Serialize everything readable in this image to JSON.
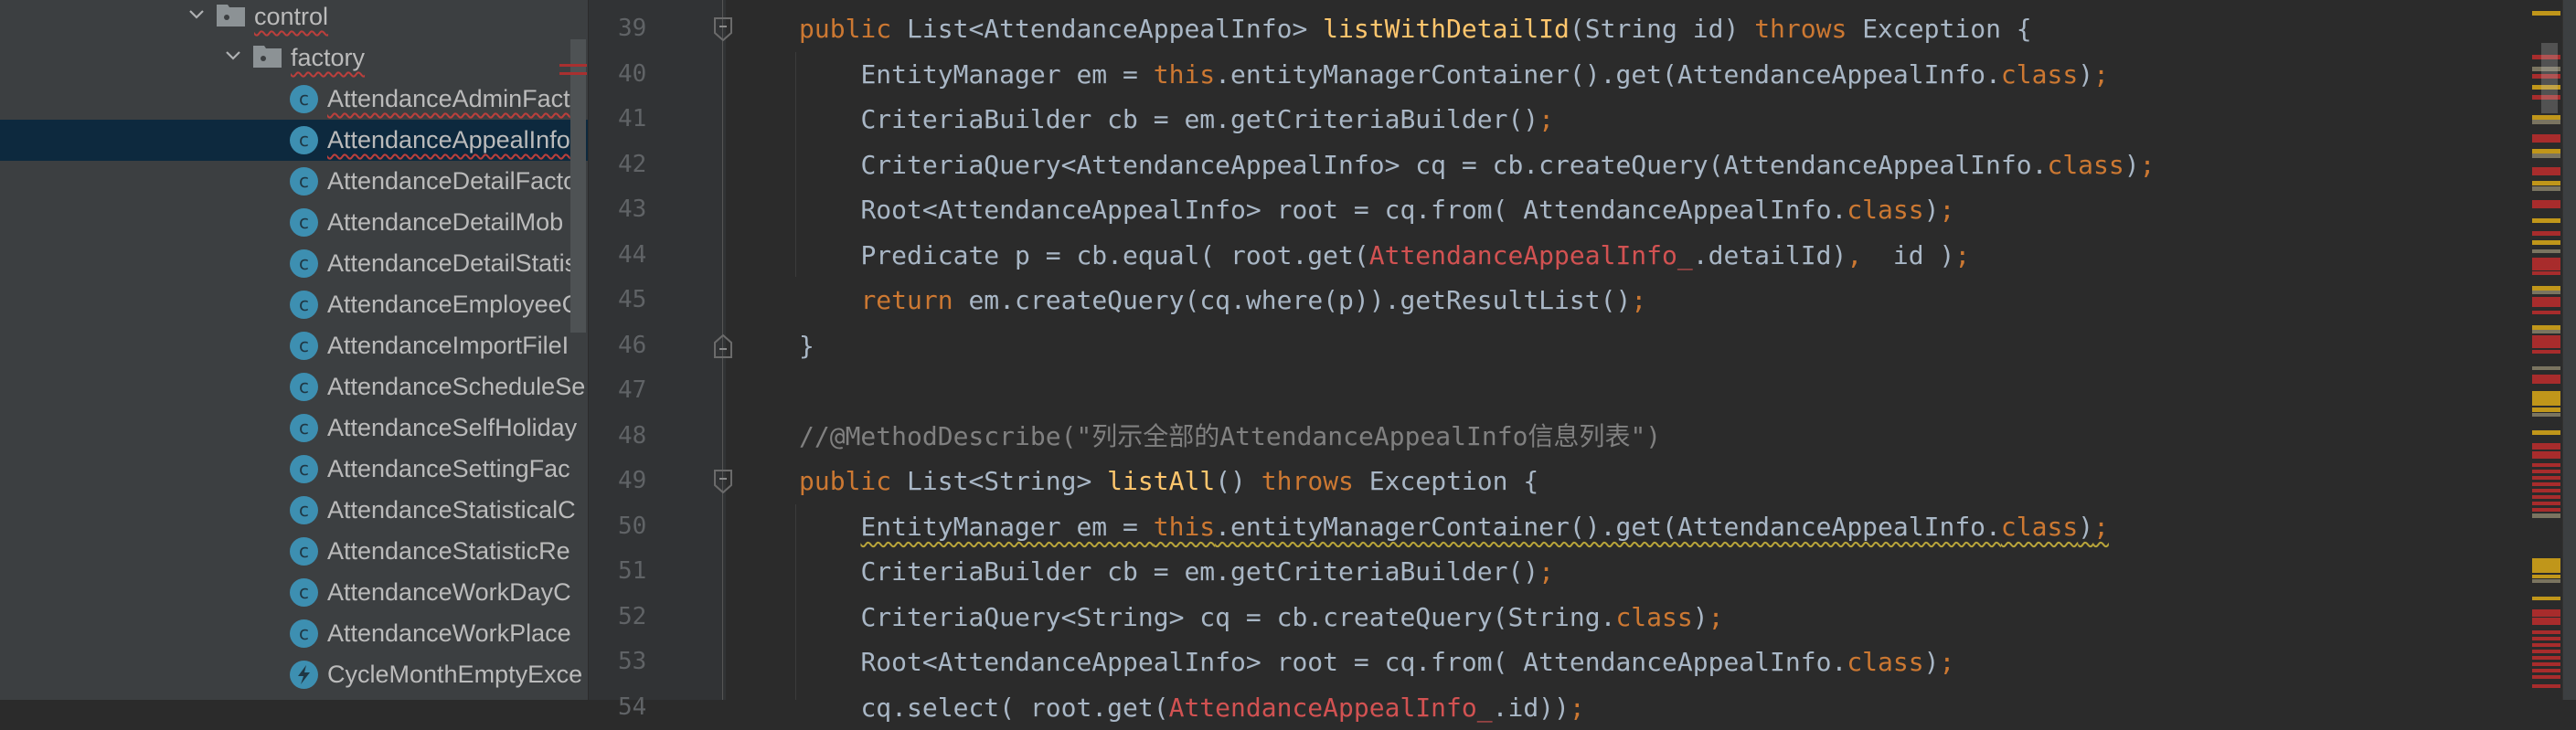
{
  "project_tree": {
    "folders": [
      {
        "name": "control",
        "expanded": true
      },
      {
        "name": "factory",
        "expanded": true
      }
    ],
    "files": [
      {
        "name": "AttendanceAdminFact",
        "type": "class",
        "error": true
      },
      {
        "name": "AttendanceAppealInfo",
        "type": "class",
        "error": true,
        "selected": true
      },
      {
        "name": "AttendanceDetailFacto",
        "type": "class"
      },
      {
        "name": "AttendanceDetailMob",
        "type": "class"
      },
      {
        "name": "AttendanceDetailStatis",
        "type": "class"
      },
      {
        "name": "AttendanceEmployeeC",
        "type": "class"
      },
      {
        "name": "AttendanceImportFileI",
        "type": "class"
      },
      {
        "name": "AttendanceScheduleSe",
        "type": "class"
      },
      {
        "name": "AttendanceSelfHoliday",
        "type": "class"
      },
      {
        "name": "AttendanceSettingFac",
        "type": "class"
      },
      {
        "name": "AttendanceStatisticalC",
        "type": "class"
      },
      {
        "name": "AttendanceStatisticRe",
        "type": "class"
      },
      {
        "name": "AttendanceWorkDayC",
        "type": "class"
      },
      {
        "name": "AttendanceWorkPlace",
        "type": "class"
      },
      {
        "name": "CycleMonthEmptyExce",
        "type": "exception"
      }
    ],
    "class_icon_glyph": "c"
  },
  "editor": {
    "lines": [
      {
        "num": "39",
        "indent": 1,
        "fold": "start",
        "tokens": [
          {
            "t": "public ",
            "c": "k"
          },
          {
            "t": "List<AttendanceAppealInfo> ",
            "c": "p"
          },
          {
            "t": "listWithDetailId",
            "c": "m"
          },
          {
            "t": "(String id) ",
            "c": "p"
          },
          {
            "t": "throws ",
            "c": "k"
          },
          {
            "t": "Exception {",
            "c": "p"
          }
        ]
      },
      {
        "num": "40",
        "indent": 2,
        "tokens": [
          {
            "t": "EntityManager em = ",
            "c": "p"
          },
          {
            "t": "this",
            "c": "k"
          },
          {
            "t": ".entityManagerContainer().get(AttendanceAppealInfo.",
            "c": "p"
          },
          {
            "t": "class",
            "c": "k"
          },
          {
            "t": ")",
            "c": "p"
          },
          {
            "t": ";",
            "c": "k"
          }
        ]
      },
      {
        "num": "41",
        "indent": 2,
        "tokens": [
          {
            "t": "CriteriaBuilder cb = em.getCriteriaBuilder()",
            "c": "p"
          },
          {
            "t": ";",
            "c": "k"
          }
        ]
      },
      {
        "num": "42",
        "indent": 2,
        "tokens": [
          {
            "t": "CriteriaQuery<AttendanceAppealInfo> cq = cb.createQuery(AttendanceAppealInfo.",
            "c": "p"
          },
          {
            "t": "class",
            "c": "k"
          },
          {
            "t": ")",
            "c": "p"
          },
          {
            "t": ";",
            "c": "k"
          }
        ]
      },
      {
        "num": "43",
        "indent": 2,
        "tokens": [
          {
            "t": "Root<AttendanceAppealInfo> root = cq.from( AttendanceAppealInfo.",
            "c": "p"
          },
          {
            "t": "class",
            "c": "k"
          },
          {
            "t": ")",
            "c": "p"
          },
          {
            "t": ";",
            "c": "k"
          }
        ]
      },
      {
        "num": "44",
        "indent": 2,
        "tokens": [
          {
            "t": "Predicate p = cb.equal( root.get(",
            "c": "p"
          },
          {
            "t": "AttendanceAppealInfo_",
            "c": "e"
          },
          {
            "t": ".detailId)",
            "c": "p"
          },
          {
            "t": ",",
            "c": "k"
          },
          {
            "t": "  id )",
            "c": "p"
          },
          {
            "t": ";",
            "c": "k"
          }
        ]
      },
      {
        "num": "45",
        "indent": 2,
        "tokens": [
          {
            "t": "return ",
            "c": "k"
          },
          {
            "t": "em.createQuery(cq.where(p)).getResultList()",
            "c": "p"
          },
          {
            "t": ";",
            "c": "k"
          }
        ]
      },
      {
        "num": "46",
        "indent": 1,
        "fold": "end",
        "tokens": [
          {
            "t": "}",
            "c": "p"
          }
        ]
      },
      {
        "num": "47",
        "indent": 0,
        "tokens": []
      },
      {
        "num": "48",
        "indent": 1,
        "tokens": [
          {
            "t": "//@MethodDescribe(\"列示全部的AttendanceAppealInfo信息列表\")",
            "c": "cm"
          }
        ]
      },
      {
        "num": "49",
        "indent": 1,
        "fold": "start",
        "tokens": [
          {
            "t": "public ",
            "c": "k"
          },
          {
            "t": "List<String> ",
            "c": "p"
          },
          {
            "t": "listAll",
            "c": "m"
          },
          {
            "t": "() ",
            "c": "p"
          },
          {
            "t": "throws ",
            "c": "k"
          },
          {
            "t": "Exception {",
            "c": "p"
          }
        ]
      },
      {
        "num": "50",
        "indent": 2,
        "warn": true,
        "tokens": [
          {
            "t": "EntityManager em = ",
            "c": "p"
          },
          {
            "t": "this",
            "c": "k"
          },
          {
            "t": ".entityManagerContainer().get(AttendanceAppealInfo.",
            "c": "p"
          },
          {
            "t": "class",
            "c": "k"
          },
          {
            "t": ")",
            "c": "p"
          },
          {
            "t": ";",
            "c": "k"
          }
        ]
      },
      {
        "num": "51",
        "indent": 2,
        "tokens": [
          {
            "t": "CriteriaBuilder cb = em.getCriteriaBuilder()",
            "c": "p"
          },
          {
            "t": ";",
            "c": "k"
          }
        ]
      },
      {
        "num": "52",
        "indent": 2,
        "tokens": [
          {
            "t": "CriteriaQuery<String> cq = cb.createQuery(String.",
            "c": "p"
          },
          {
            "t": "class",
            "c": "k"
          },
          {
            "t": ")",
            "c": "p"
          },
          {
            "t": ";",
            "c": "k"
          }
        ]
      },
      {
        "num": "53",
        "indent": 2,
        "tokens": [
          {
            "t": "Root<AttendanceAppealInfo> root = cq.from( AttendanceAppealInfo.",
            "c": "p"
          },
          {
            "t": "class",
            "c": "k"
          },
          {
            "t": ")",
            "c": "p"
          },
          {
            "t": ";",
            "c": "k"
          }
        ]
      },
      {
        "num": "54",
        "indent": 2,
        "tokens": [
          {
            "t": "cq.select( root.get(",
            "c": "p"
          },
          {
            "t": "AttendanceAppealInfo_",
            "c": "e"
          },
          {
            "t": ".id))",
            "c": "p"
          },
          {
            "t": ";",
            "c": "k"
          }
        ]
      }
    ]
  },
  "colors": {
    "keyword": "#cc7832",
    "method": "#ffc66d",
    "error": "#d25252",
    "comment": "#808080",
    "text": "#a9b7c6",
    "selection": "#0d293e"
  }
}
